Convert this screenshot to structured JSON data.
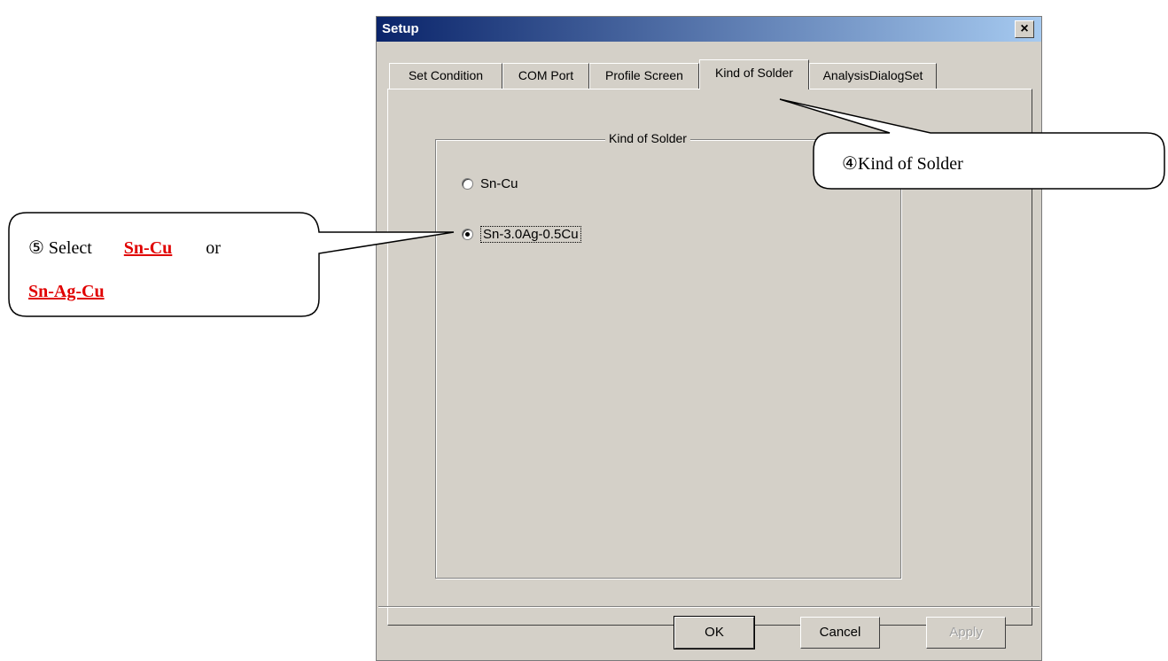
{
  "dialog": {
    "title": "Setup",
    "close_glyph": "×",
    "tabs": [
      {
        "label": "Set Condition",
        "active": false
      },
      {
        "label": "COM Port",
        "active": false
      },
      {
        "label": "Profile Screen",
        "active": false
      },
      {
        "label": "Kind of Solder",
        "active": true
      },
      {
        "label": "AnalysisDialogSet",
        "active": false
      }
    ],
    "group": {
      "legend": "Kind of Solder",
      "options": [
        {
          "label": "Sn-Cu",
          "selected": false
        },
        {
          "label": "Sn-3.0Ag-0.5Cu",
          "selected": true
        }
      ]
    },
    "buttons": {
      "ok": "OK",
      "cancel": "Cancel",
      "apply": "Apply"
    }
  },
  "callouts": {
    "kind_of_solder": "④Kind of Solder",
    "select": {
      "prefix": "⑤ Select",
      "option1": "Sn-Cu",
      "or": "or",
      "option2": "Sn-Ag-Cu"
    }
  },
  "colors": {
    "titlebar_start": "#0a246a",
    "titlebar_end": "#a6caf0",
    "dialog_face": "#d4d0c8",
    "highlight_red": "#e00000"
  },
  "icons": {
    "close": "close-icon"
  }
}
